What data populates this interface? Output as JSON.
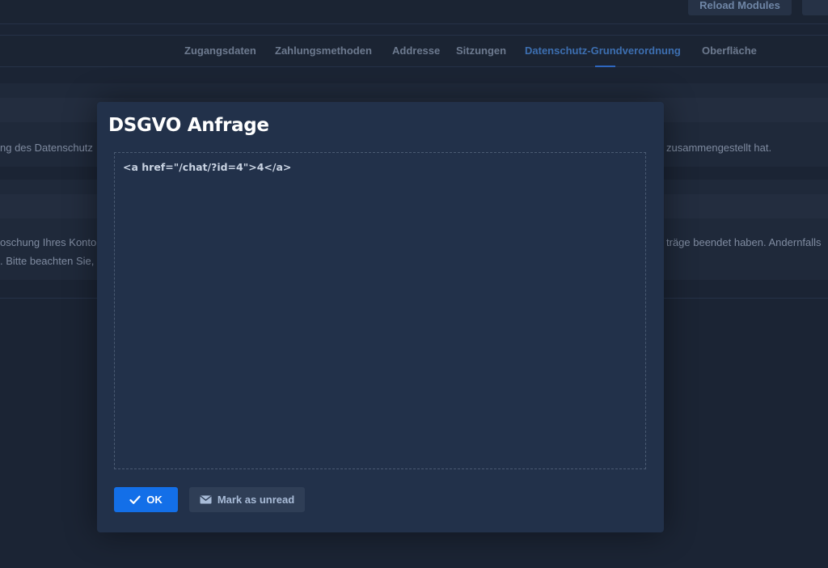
{
  "header": {
    "reload_label": "Reload Modules"
  },
  "tabs": [
    {
      "label": "Zugangsdaten",
      "active": false
    },
    {
      "label": "Zahlungsmethoden",
      "active": false
    },
    {
      "label": "Addresse",
      "active": false
    },
    {
      "label": "Sitzungen",
      "active": false
    },
    {
      "label": "Datenschutz-Grundverordnung",
      "active": true
    },
    {
      "label": "Oberfläche",
      "active": false
    }
  ],
  "background": {
    "card1_text_left": "ng des Datenschutz",
    "card1_text_right": "zusammengestellt hat.",
    "card2_text_left_1": "oschung Ihres Konto",
    "card2_text_left_2": ". Bitte beachten Sie,",
    "card2_text_right": "träge beendet haben. Andernfalls"
  },
  "modal": {
    "title": "DSGVO Anfrage",
    "content": "<a href=\"/chat/?id=4\">4</a>",
    "ok_label": "OK",
    "unread_label": "Mark as unread"
  },
  "icons": {
    "ok": "check-icon",
    "unread": "envelope-icon"
  },
  "colors": {
    "accent": "#136fe8",
    "background": "#1b2434",
    "modal": "#22314a"
  }
}
